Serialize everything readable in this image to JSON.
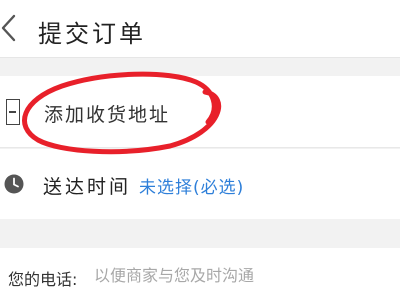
{
  "header": {
    "title": "提交订单",
    "back_icon": "chevron-left-icon"
  },
  "address": {
    "label": "添加收货地址",
    "icon": "address-card-icon"
  },
  "delivery": {
    "icon": "clock-icon",
    "label": "送达时间",
    "value": "未选择(必选)"
  },
  "phone": {
    "label": "您的电话:",
    "placeholder": "以便商家与您及时沟通"
  },
  "annotation": {
    "type": "hand-drawn-circle",
    "color": "#e8202a"
  },
  "colors": {
    "link": "#2e7fd9",
    "background": "#f2f2f2",
    "annotation": "#e8202a"
  }
}
